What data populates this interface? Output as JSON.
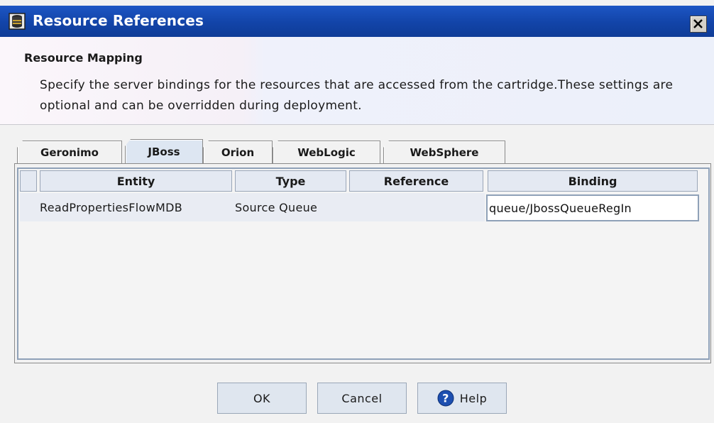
{
  "window": {
    "title": "Resource References"
  },
  "header": {
    "title": "Resource Mapping",
    "description": "Specify the server bindings for the resources that are accessed from the cartridge.These settings are optional and can be overridden during deployment."
  },
  "tabs": [
    {
      "label": "Geronimo",
      "selected": false
    },
    {
      "label": "JBoss",
      "selected": true
    },
    {
      "label": "Orion",
      "selected": false
    },
    {
      "label": "WebLogic",
      "selected": false
    },
    {
      "label": "WebSphere",
      "selected": false
    }
  ],
  "table": {
    "columns": [
      "Entity",
      "Type",
      "Reference",
      "Binding"
    ],
    "rows": [
      {
        "entity": "ReadPropertiesFlowMDB",
        "type": "Source Queue",
        "reference": "",
        "binding": "queue/JbossQueueRegIn"
      }
    ]
  },
  "buttons": {
    "ok": "OK",
    "cancel": "Cancel",
    "help": "Help"
  },
  "icons": {
    "window": "app-window-icon",
    "close": "close-icon",
    "help": "help-icon"
  },
  "colors": {
    "titlebar": "#1244a8",
    "selected_tab": "#dde6f2",
    "button_face": "#dfe6ef"
  }
}
